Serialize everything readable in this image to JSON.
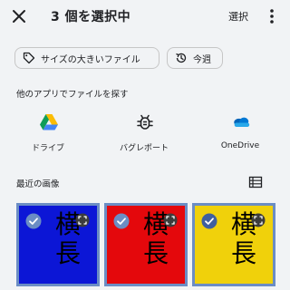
{
  "topbar": {
    "title": "3 個を選択中",
    "select_label": "選択"
  },
  "chips": [
    {
      "label": "サイズの大きいファイル",
      "icon": "tag-icon"
    },
    {
      "label": "今週",
      "icon": "history-icon"
    }
  ],
  "apps_section": {
    "heading": "他のアプリでファイルを探す",
    "apps": [
      {
        "label": "ドライブ",
        "icon": "google-drive-icon"
      },
      {
        "label": "バグレポート",
        "icon": "bug-icon"
      },
      {
        "label": "OneDrive",
        "icon": "onedrive-icon"
      }
    ]
  },
  "recent_section": {
    "heading": "最近の画像",
    "images": [
      {
        "color": "#0c16d6",
        "text1": "横",
        "text2": "長",
        "selected": true
      },
      {
        "color": "#e4080c",
        "text1": "横",
        "text2": "長",
        "selected": true
      },
      {
        "color": "#f0d10b",
        "text1": "横",
        "text2": "長",
        "selected": true
      }
    ]
  },
  "colors": {
    "background": "#f1f3f5",
    "selection_border": "#6b8dc4"
  }
}
